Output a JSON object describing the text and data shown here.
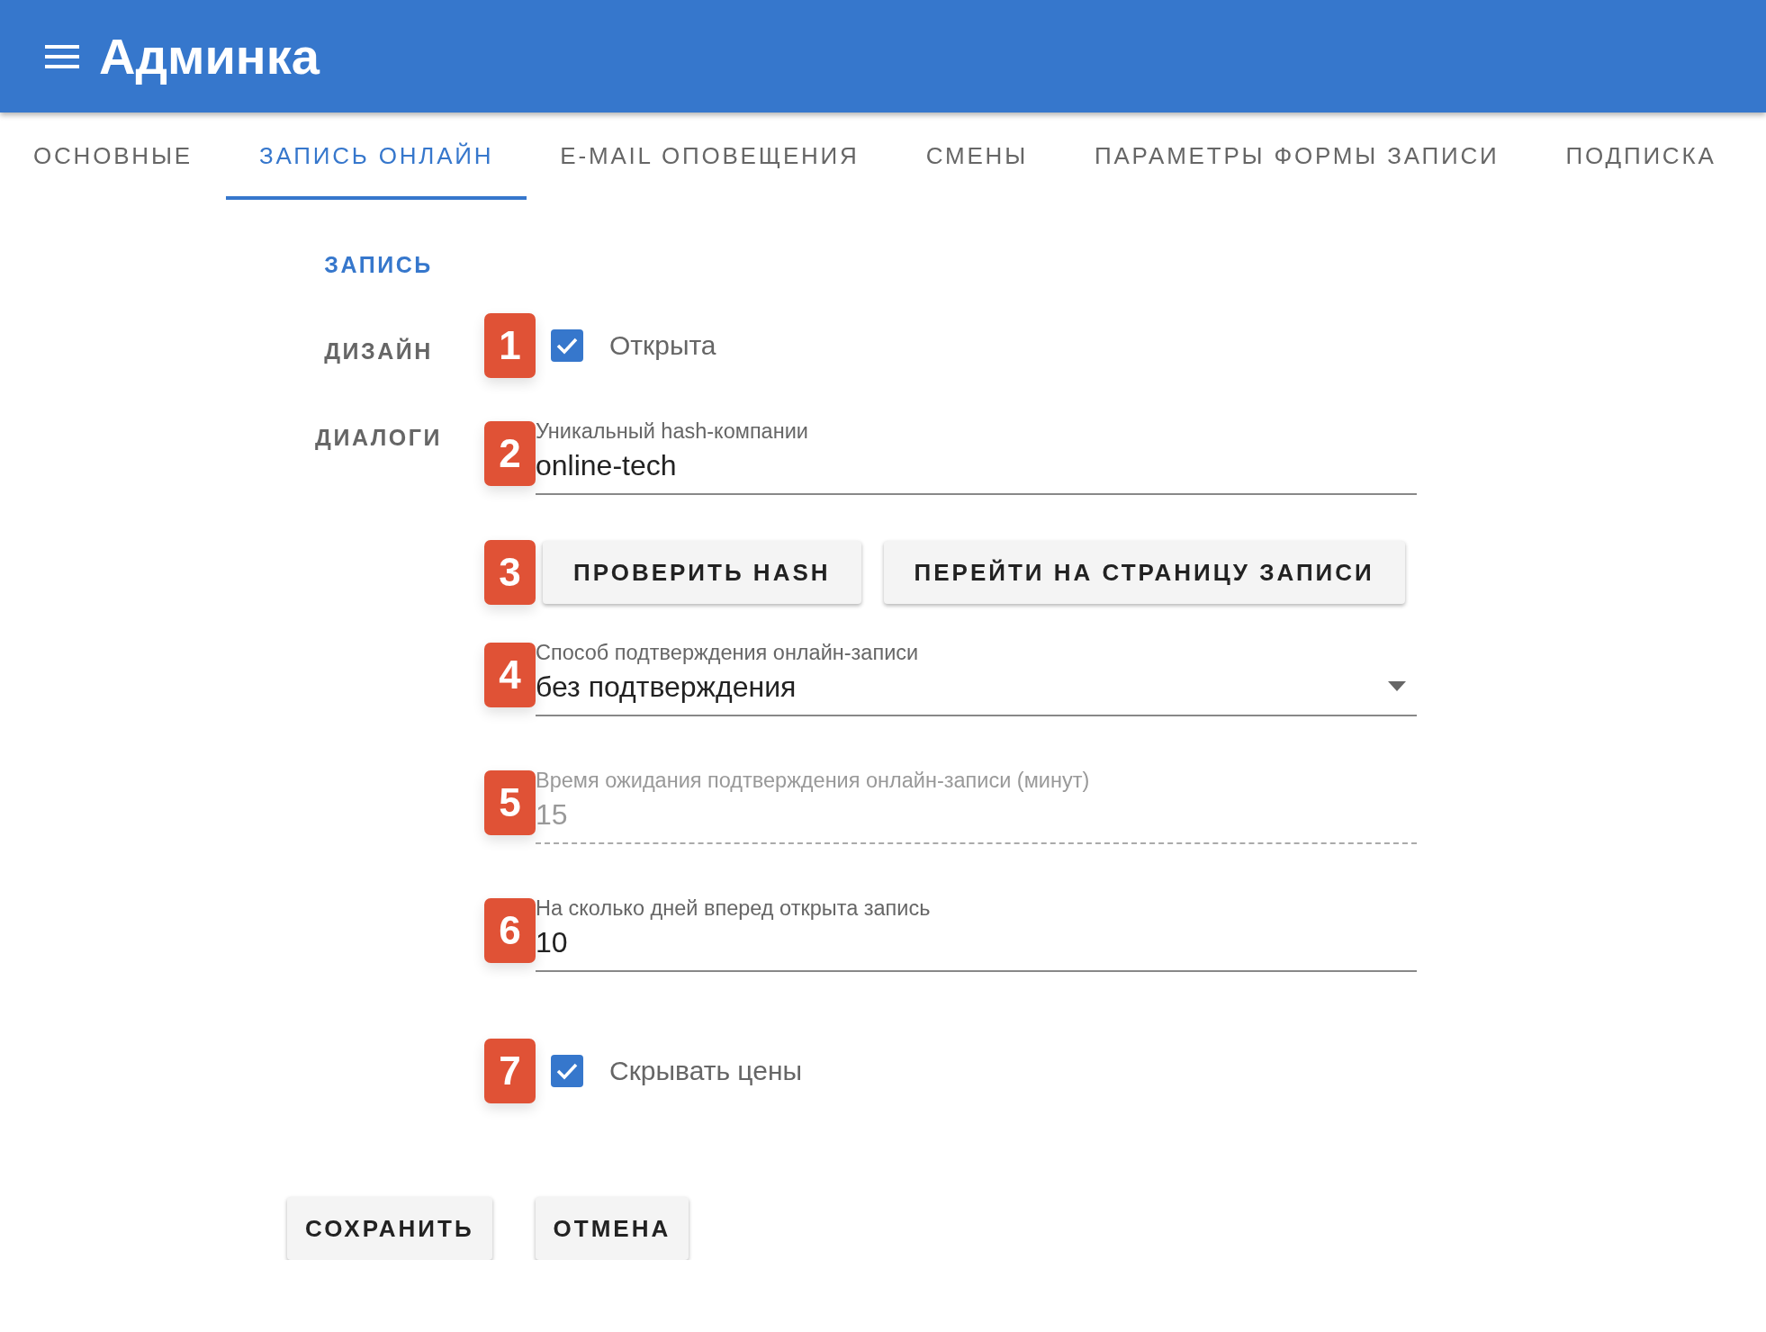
{
  "header": {
    "title": "Админка"
  },
  "tabs": [
    {
      "label": "ОСНОВНЫЕ",
      "selected": false
    },
    {
      "label": "ЗАПИСЬ ОНЛАЙН",
      "selected": true
    },
    {
      "label": "E-MAIL ОПОВЕЩЕНИЯ",
      "selected": false
    },
    {
      "label": "СМЕНЫ",
      "selected": false
    },
    {
      "label": "ПАРАМЕТРЫ ФОРМЫ ЗАПИСИ",
      "selected": false
    },
    {
      "label": "ПОДПИСКА",
      "selected": false
    }
  ],
  "side_nav": [
    {
      "label": "ЗАПИСЬ",
      "selected": true
    },
    {
      "label": "ДИЗАЙН",
      "selected": false
    },
    {
      "label": "ДИАЛОГИ",
      "selected": false
    }
  ],
  "form": [
    {
      "kind": "checkbox",
      "marker": "1",
      "label": "Открыта",
      "checked": true
    },
    {
      "kind": "text",
      "marker": "2",
      "label": "Уникальный hash-компании",
      "value": "online-tech",
      "disabled": false
    },
    {
      "kind": "buttons",
      "marker": "3",
      "buttons": [
        "ПРОВЕРИТЬ HASH",
        "ПЕРЕЙТИ НА СТРАНИЦУ ЗАПИСИ"
      ]
    },
    {
      "kind": "select",
      "marker": "4",
      "label": "Способ подтверждения онлайн-записи",
      "value": "без подтверждения",
      "disabled": false
    },
    {
      "kind": "text",
      "marker": "5",
      "label": "Время ожидания подтверждения онлайн-записи (минут)",
      "value": "15",
      "disabled": true
    },
    {
      "kind": "text",
      "marker": "6",
      "label": "На сколько дней вперед открыта запись",
      "value": "10",
      "disabled": false
    },
    {
      "kind": "checkbox",
      "marker": "7",
      "label": "Скрывать цены",
      "checked": true
    }
  ],
  "actions": [
    "СОХРАНИТЬ",
    "ОТМЕНА"
  ]
}
